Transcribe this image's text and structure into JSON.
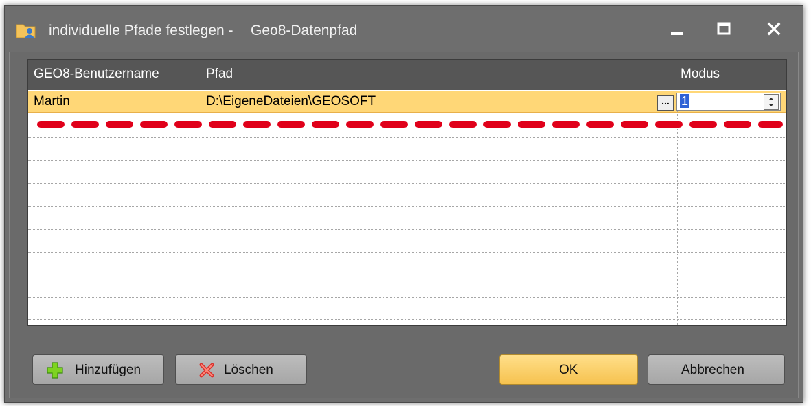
{
  "window": {
    "title": "individuelle Pfade festlegen -",
    "subtitle": "Geo8-Datenpfad",
    "controls": {
      "minimize": "minimize-icon",
      "maximize": "maximize-icon",
      "close": "close-icon"
    }
  },
  "grid": {
    "columns": [
      {
        "label": "GEO8-Benutzername"
      },
      {
        "label": "Pfad"
      },
      {
        "label": "Modus"
      }
    ],
    "rows": [
      {
        "user": "Martin",
        "path": "D:\\EigeneDateien\\GEOSOFT",
        "ellipsis": "...",
        "modus": "1"
      }
    ]
  },
  "buttons": {
    "add": "Hinzufügen",
    "delete": "Löschen",
    "ok": "OK",
    "cancel": "Abbrechen"
  },
  "colors": {
    "selected_row": "#ffd777",
    "annotation": "#e0001a",
    "ok_button": "#f6c24f"
  }
}
